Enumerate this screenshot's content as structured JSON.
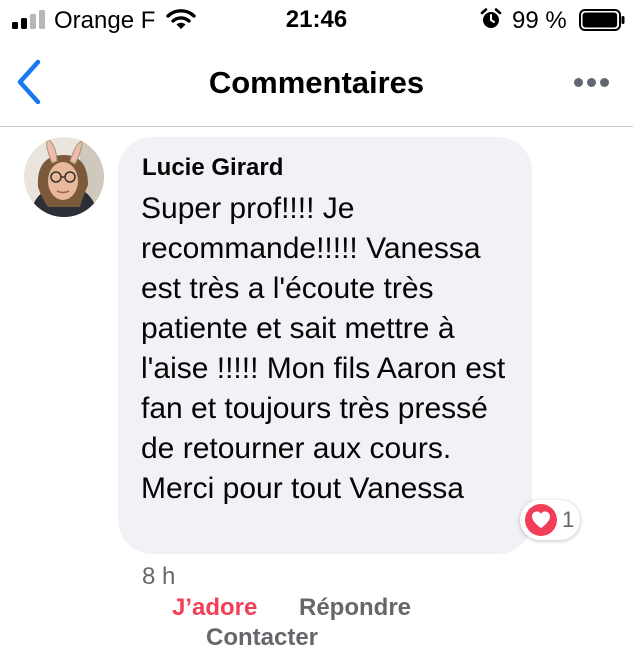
{
  "status_bar": {
    "carrier": "Orange F",
    "time": "21:46",
    "battery_percent": "99 %",
    "battery_level": 0.99,
    "icons": [
      "signal-icon",
      "wifi-icon",
      "alarm-icon",
      "battery-icon"
    ]
  },
  "nav": {
    "title": "Commentaires",
    "back_icon": "chevron-left-icon",
    "more_icon": "more-icon"
  },
  "colors": {
    "accent_blue": "#1877f2",
    "love_red": "#f33e58",
    "bubble_bg": "#f0f2f5",
    "secondary_text": "#65676b"
  },
  "comment": {
    "author": "Lucie Girard",
    "text": "Super prof!!!! Je recommande!!!!! Vanessa est très a l'écoute très patiente et sait mettre à l'aise !!!!! Mon fils Aaron est fan et toujours très pressé de retourner aux cours. Merci pour tout Vanessa",
    "reaction_count": "1",
    "reaction_icon": "heart-icon",
    "time": "8 h",
    "actions": {
      "love": "J’adore",
      "reply": "Répondre",
      "contact": "Contacter"
    }
  }
}
